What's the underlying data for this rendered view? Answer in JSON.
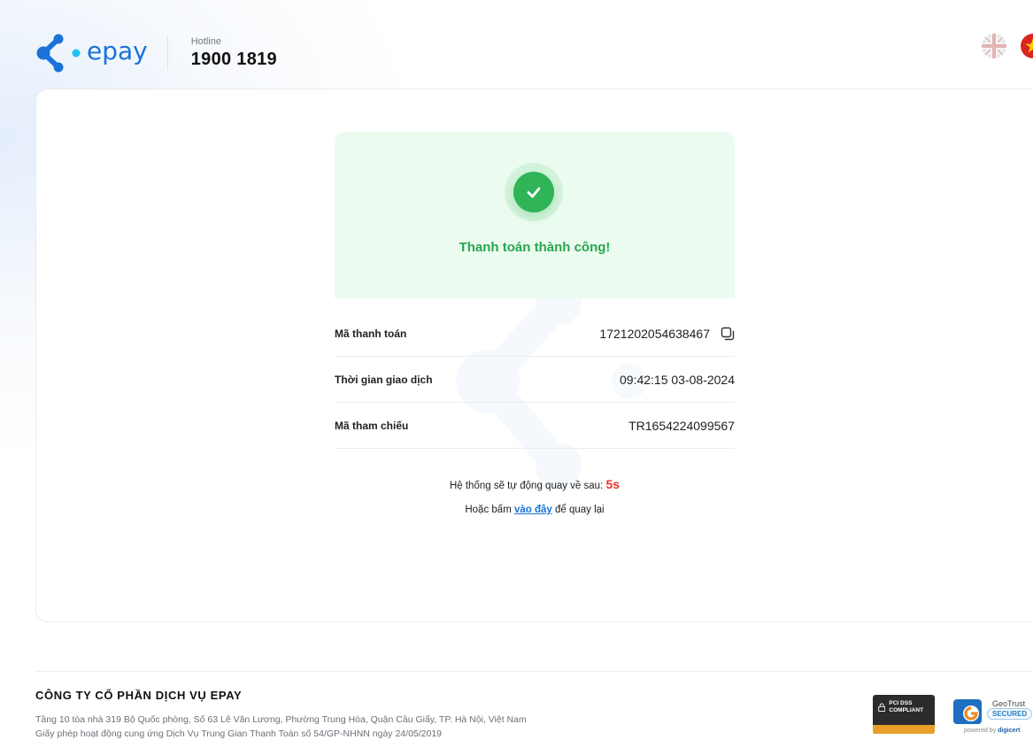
{
  "header": {
    "brand": "epay",
    "hotline_label": "Hotline",
    "hotline_number": "1900 1819"
  },
  "languages": [
    {
      "code": "en",
      "icon": "uk-flag-icon"
    },
    {
      "code": "vi",
      "icon": "vietnam-flag-icon"
    }
  ],
  "result": {
    "title": "Thanh toán thành công!",
    "icon": "checkmark-icon"
  },
  "details": [
    {
      "label": "Mã thanh toán",
      "value": "1721202054638467",
      "copyable": true
    },
    {
      "label": "Thời gian giao dịch",
      "value": "09:42:15 03-08-2024"
    },
    {
      "label": "Mã tham chiếu",
      "value": "TR1654224099567"
    }
  ],
  "redirect": {
    "text": "Hệ thống sẽ tự động quay về sau: ",
    "countdown": "5s",
    "back_prefix": "Hoặc bấm ",
    "back_link": "vào đây",
    "back_suffix": " để quay lại"
  },
  "footer": {
    "company": "CÔNG TY CỔ PHẦN DỊCH VỤ EPAY",
    "address": "Tầng 10 tòa nhà 319 Bộ Quốc phòng, Số 63 Lê Văn Lương, Phường Trung Hòa, Quận Cầu Giấy, TP. Hà Nội, Việt Nam",
    "license": "Giấy phép hoạt động cung ứng Dịch Vụ Trung Gian Thanh Toán số 54/GP-NHNN ngày 24/05/2019",
    "badges": {
      "pci": "PCI DSS COMPLIANT",
      "geotrust_name": "GeoTrust",
      "geotrust_status": "SECURED",
      "geotrust_powered_prefix": "powered by ",
      "geotrust_powered_brand": "digicert"
    }
  },
  "colors": {
    "brand_blue": "#1a73d8",
    "success_green": "#2fb457",
    "countdown_red": "#e5332a"
  }
}
